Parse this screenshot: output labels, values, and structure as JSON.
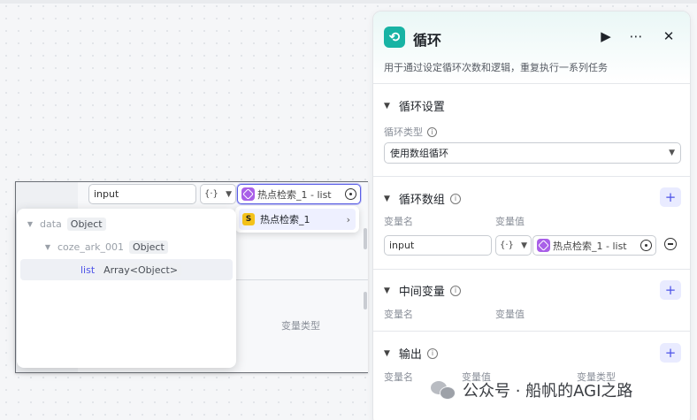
{
  "overlay": {
    "input_value": "input",
    "type_select_label": "{·}",
    "value_ref": "热点检索_1 - list",
    "type_column_label": "变量类型"
  },
  "submenu": {
    "icon_letter": "S",
    "label": "热点检索_1"
  },
  "tree": {
    "rows": [
      {
        "name": "data",
        "type": "Object"
      },
      {
        "name": "coze_ark_001",
        "type": "Object"
      },
      {
        "name": "list",
        "type": "Array<Object>"
      }
    ]
  },
  "panel": {
    "title": "循环",
    "description": "用于通过设定循环次数和逻辑，重复执行一系列任务",
    "loop_settings": {
      "title": "循环设置",
      "type_label": "循环类型",
      "type_value": "使用数组循环"
    },
    "loop_array": {
      "title": "循环数组",
      "col_name": "变量名",
      "col_value": "变量值",
      "item_name": "input",
      "item_type_label": "{·}",
      "item_value": "热点检索_1 - list"
    },
    "intermediate": {
      "title": "中间变量",
      "col_name": "变量名",
      "col_value": "变量值"
    },
    "output": {
      "title": "输出",
      "col_name": "变量名",
      "col_value": "变量值",
      "col_type": "变量类型"
    }
  },
  "watermark": "公众号 · 船帆的AGI之路",
  "colors": {
    "accent": "#4d53e8",
    "loop_icon": "#18b3a4",
    "plugin": "#a95fe8"
  }
}
